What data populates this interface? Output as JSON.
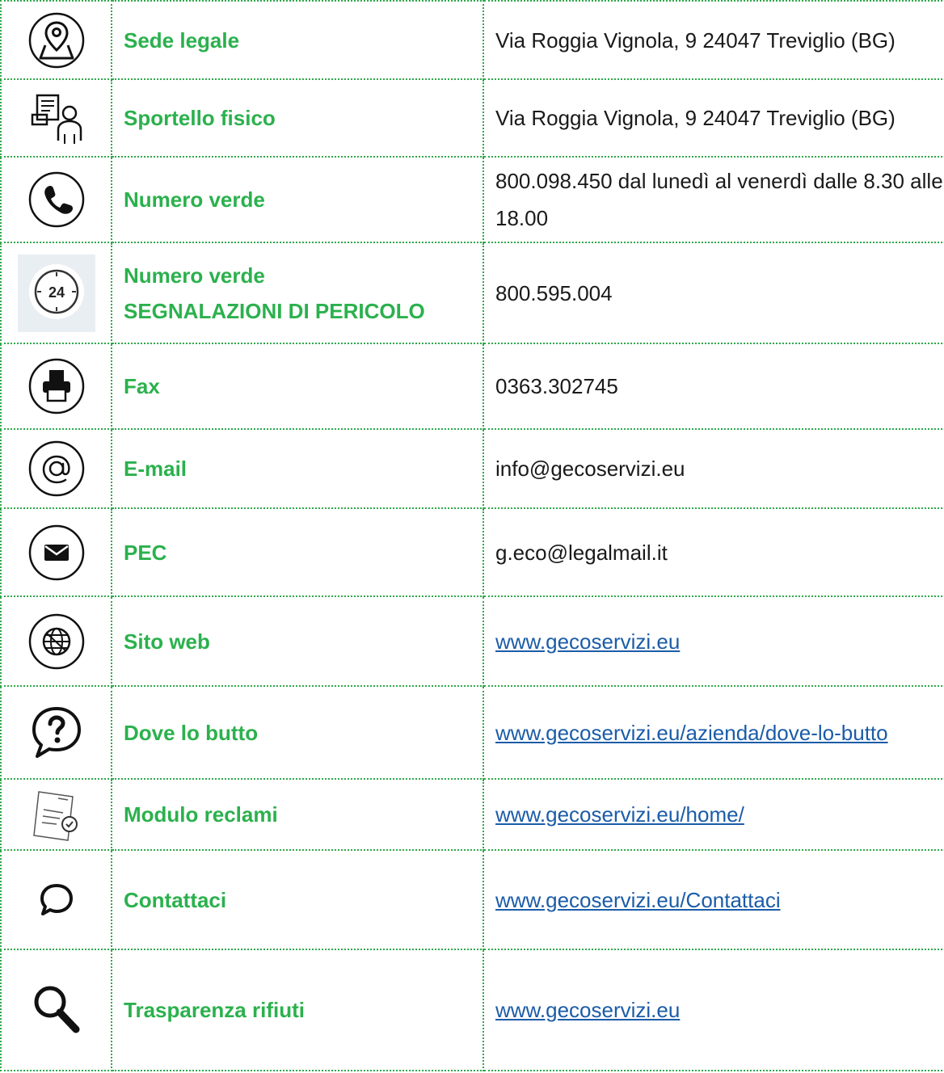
{
  "rows": [
    {
      "icon": "location-pin-icon",
      "label": "Sede legale",
      "value": "Via Roggia Vignola, 9 24047 Treviglio (BG)",
      "is_link": false
    },
    {
      "icon": "service-desk-icon",
      "label": "Sportello fisico",
      "value": "Via Roggia Vignola, 9 24047 Treviglio (BG)",
      "is_link": false
    },
    {
      "icon": "phone-icon",
      "label": "Numero verde",
      "value": "800.098.450 dal lunedì al venerdì dalle 8.30 alle 18.00",
      "is_link": false
    },
    {
      "icon": "clock-24-icon",
      "label_line1": "Numero verde",
      "label_line2": "SEGNALAZIONI DI PERICOLO",
      "value": "800.595.004",
      "is_link": false
    },
    {
      "icon": "fax-printer-icon",
      "label": "Fax",
      "value": "0363.302745",
      "is_link": false
    },
    {
      "icon": "at-sign-icon",
      "label": "E-mail",
      "value": "info@gecoservizi.eu",
      "is_link": false
    },
    {
      "icon": "envelope-icon",
      "label": "PEC",
      "value": "g.eco@legalmail.it",
      "is_link": false
    },
    {
      "icon": "globe-icon",
      "label": "Sito web",
      "value": "www.gecoservizi.eu",
      "is_link": true
    },
    {
      "icon": "question-bubble-icon",
      "label": "Dove lo butto",
      "value": "www.gecoservizi.eu/azienda/dove-lo-butto",
      "is_link": true
    },
    {
      "icon": "document-check-icon",
      "label": "Modulo reclami",
      "value": "www.gecoservizi.eu/home/",
      "is_link": true
    },
    {
      "icon": "chat-bubble-icon",
      "label": "Contattaci",
      "value": "www.gecoservizi.eu/Contattaci",
      "is_link": true
    },
    {
      "icon": "magnifier-icon",
      "label": "Trasparenza rifiuti",
      "value": "www.gecoservizi.eu",
      "is_link": true
    }
  ],
  "colors": {
    "label_green": "#2bb14d",
    "border_green": "#2fa84a",
    "link_blue": "#1b5ca8",
    "text_dark": "#1a1a1a"
  }
}
